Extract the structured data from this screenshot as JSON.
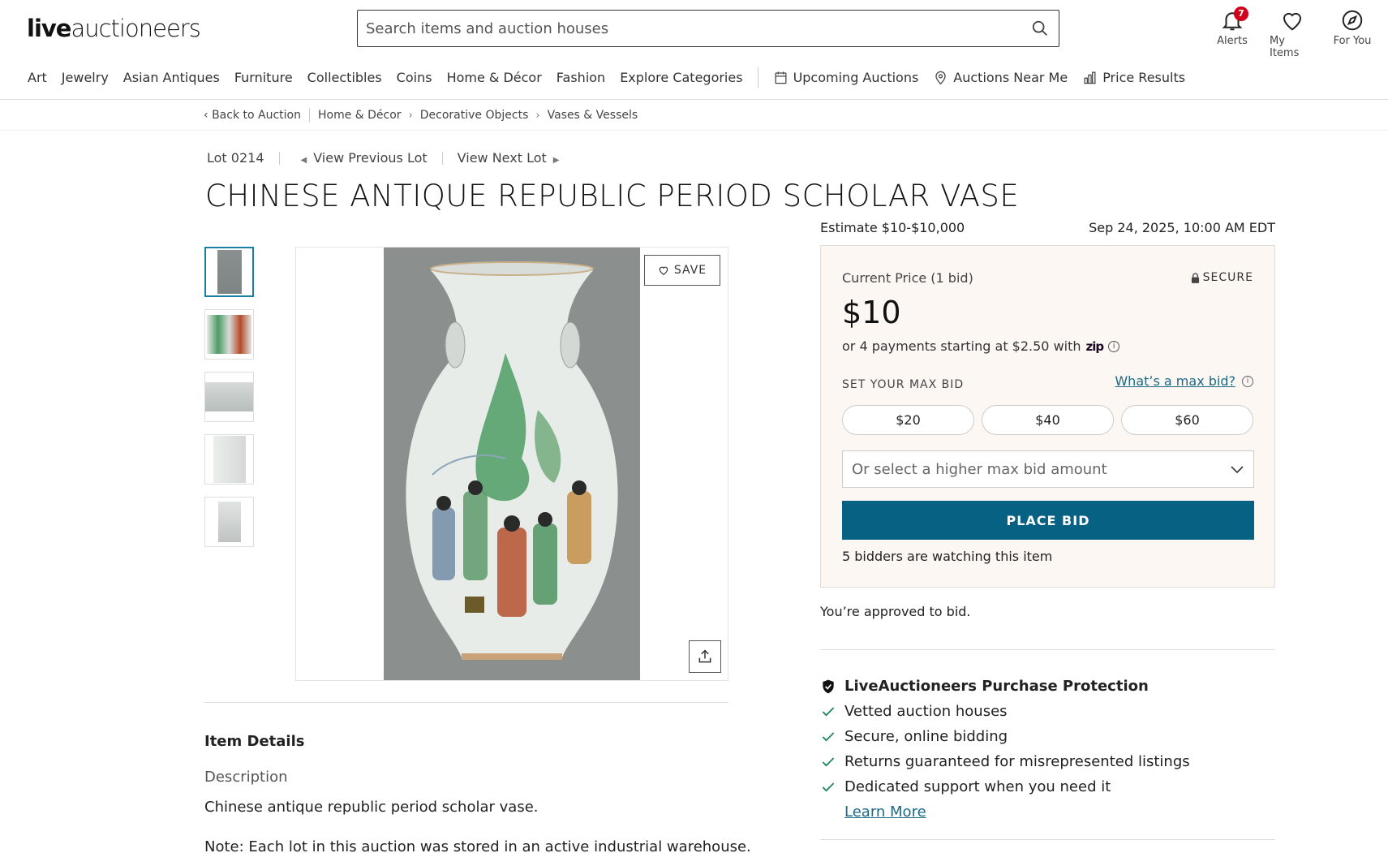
{
  "header": {
    "logo_bold": "live",
    "logo_light": "auctioneers",
    "search_placeholder": "Search items and auction houses",
    "alerts_label": "Alerts",
    "alerts_count": "7",
    "my_items_label": "My Items",
    "for_you_label": "For You"
  },
  "nav": {
    "items": [
      "Art",
      "Jewelry",
      "Asian Antiques",
      "Furniture",
      "Collectibles",
      "Coins",
      "Home & Décor",
      "Fashion",
      "Explore Categories"
    ],
    "upcoming": "Upcoming Auctions",
    "near_me": "Auctions Near Me",
    "price_results": "Price Results"
  },
  "breadcrumbs": {
    "back": "Back to Auction",
    "items": [
      "Home & Décor",
      "Decorative Objects",
      "Vases & Vessels"
    ]
  },
  "lot": {
    "number": "Lot 0214",
    "previous": "View Previous Lot",
    "next": "View Next Lot",
    "title": "CHINESE ANTIQUE REPUBLIC PERIOD SCHOLAR VASE"
  },
  "gallery": {
    "save_label": "SAVE",
    "thumb_count": 5
  },
  "details": {
    "heading": "Item Details",
    "description_label": "Description",
    "description": "Chinese antique republic period scholar vase.",
    "note": "Note: Each lot in this auction was stored in an active industrial warehouse."
  },
  "bidding": {
    "estimate": "Estimate $10-$10,000",
    "date": "Sep 24, 2025, 10:00 AM EDT",
    "current_label": "Current Price (1 bid)",
    "secure_label": "SECURE",
    "price": "$10",
    "zip_text": "or 4 payments starting at $2.50 with",
    "zip_logo": "zip",
    "max_bid_label": "SET YOUR MAX BID",
    "what_max_bid": "What’s a max bid?",
    "amounts": [
      "$20",
      "$40",
      "$60"
    ],
    "select_placeholder": "Or select a higher max bid amount",
    "place_bid": "PLACE BID",
    "watching": "5 bidders are watching this item",
    "approved": "You’re approved to bid."
  },
  "protection": {
    "title": "LiveAuctioneers Purchase Protection",
    "items": [
      "Vetted auction houses",
      "Secure, online bidding",
      "Returns guaranteed for misrepresented listings",
      "Dedicated support when you need it"
    ],
    "learn_more": "Learn More"
  },
  "colors": {
    "accent": "#066182",
    "link": "#1a6a85",
    "badge": "#d0021b",
    "bidbox_bg": "#fdf7f3"
  }
}
